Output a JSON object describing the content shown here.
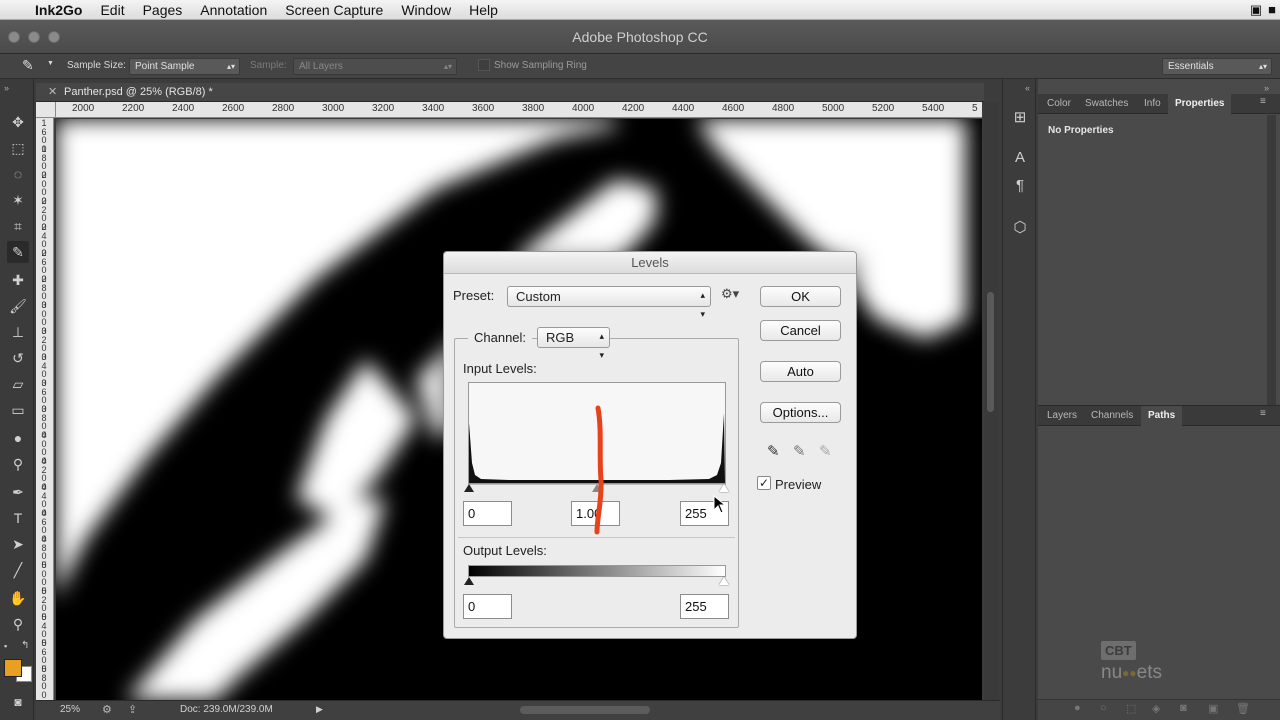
{
  "menubar": {
    "app": "Ink2Go",
    "items": [
      "Edit",
      "Pages",
      "Annotation",
      "Screen Capture",
      "Window",
      "Help"
    ]
  },
  "window": {
    "title": "Adobe Photoshop CC"
  },
  "options_bar": {
    "sample_size_label": "Sample Size:",
    "sample_size_value": "Point Sample",
    "sample_label": "Sample:",
    "sample_value": "All Layers",
    "show_ring_label": "Show Sampling Ring",
    "workspace_value": "Essentials"
  },
  "document": {
    "tab_title": "Panther.psd @ 25% (RGB/8) *",
    "ruler_h": [
      "2000",
      "2200",
      "2400",
      "2600",
      "2800",
      "3000",
      "3200",
      "3400",
      "3600",
      "3800",
      "4000",
      "4200",
      "4400",
      "4600",
      "4800",
      "5000",
      "5200",
      "5400",
      "5"
    ],
    "ruler_v": [
      "1\n6\n0\n0",
      "1\n8\n0\n0",
      "2\n0\n0\n0",
      "2\n2\n0\n0",
      "2\n4\n0\n0",
      "2\n6\n0\n0",
      "2\n8\n0\n0",
      "3\n0\n0\n0",
      "3\n2\n0\n0",
      "3\n4\n0\n0",
      "3\n6\n0\n0",
      "3\n8\n0\n0",
      "4\n0\n0\n0",
      "4\n2\n0\n0",
      "4\n4\n0\n0",
      "4\n6\n0\n0",
      "4\n8\n0\n0",
      "5\n0\n0\n0",
      "5\n2\n0\n0",
      "5\n4\n0\n0",
      "5\n6\n0\n0",
      "5\n8\n0\n0"
    ]
  },
  "status": {
    "zoom": "25%",
    "doc": "Doc: 239.0M/239.0M"
  },
  "right_panel": {
    "top_tabs": [
      "Color",
      "Swatches",
      "Info",
      "Properties"
    ],
    "properties_text": "No Properties",
    "bottom_tabs": [
      "Layers",
      "Channels",
      "Paths"
    ]
  },
  "levels_dialog": {
    "title": "Levels",
    "preset_label": "Preset:",
    "preset_value": "Custom",
    "channel_label": "Channel:",
    "channel_value": "RGB",
    "input_levels_label": "Input Levels:",
    "input_black": "0",
    "input_gamma": "1.00",
    "input_white": "255",
    "output_levels_label": "Output Levels:",
    "output_black": "0",
    "output_white": "255",
    "buttons": {
      "ok": "OK",
      "cancel": "Cancel",
      "auto": "Auto",
      "options": "Options..."
    },
    "preview_label": "Preview",
    "preview_checked": true
  },
  "watermark": {
    "text_a": "CBT",
    "text_b": "nu",
    "text_c": "ets"
  },
  "colors": {
    "foreground": "#e8a020",
    "annotation": "#e8421c"
  }
}
